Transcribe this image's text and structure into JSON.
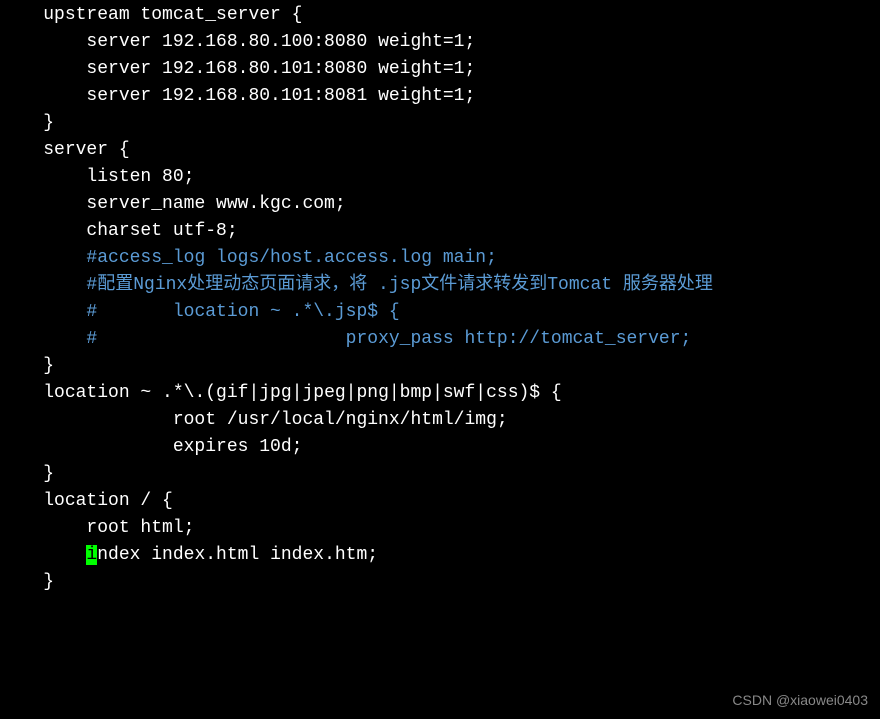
{
  "code_lines": [
    {
      "text": "    upstream tomcat_server {",
      "class": "white"
    },
    {
      "text": "        server 192.168.80.100:8080 weight=1;",
      "class": "white"
    },
    {
      "text": "        server 192.168.80.101:8080 weight=1;",
      "class": "white"
    },
    {
      "text": "        server 192.168.80.101:8081 weight=1;",
      "class": "white"
    },
    {
      "text": "    }",
      "class": "white"
    },
    {
      "text": "    server {",
      "class": "white"
    },
    {
      "text": "        listen 80;",
      "class": "white"
    },
    {
      "text": "        server_name www.kgc.com;",
      "class": "white"
    },
    {
      "text": "",
      "class": "white"
    },
    {
      "text": "        charset utf-8;",
      "class": "white"
    },
    {
      "text": "",
      "class": "white"
    },
    {
      "text": "        #access_log logs/host.access.log main;",
      "class": "blue"
    },
    {
      "text": "        #配置Nginx处理动态页面请求，将 .jsp文件请求转发到Tomcat 服务器处理",
      "class": "blue"
    },
    {
      "text": "        #       location ~ .*\\.jsp$ {",
      "class": "blue"
    },
    {
      "text": "        #                       proxy_pass http://tomcat_server;",
      "class": "blue"
    },
    {
      "text": "    }",
      "class": "white"
    },
    {
      "text": "    location ~ .*\\.(gif|jpg|jpeg|png|bmp|swf|css)$ {",
      "class": "white"
    },
    {
      "text": "                root /usr/local/nginx/html/img;",
      "class": "white"
    },
    {
      "text": "                expires 10d;",
      "class": "white"
    },
    {
      "text": "    }",
      "class": "white"
    },
    {
      "text": "",
      "class": "white"
    },
    {
      "text": "    location / {",
      "class": "white"
    },
    {
      "text": "        root html;",
      "class": "white"
    },
    {
      "text": "        ",
      "class": "white",
      "cursor_char": "i",
      "after_cursor": "ndex index.html index.htm;"
    },
    {
      "text": "    }",
      "class": "white"
    }
  ],
  "watermark": "CSDN @xiaowei0403"
}
